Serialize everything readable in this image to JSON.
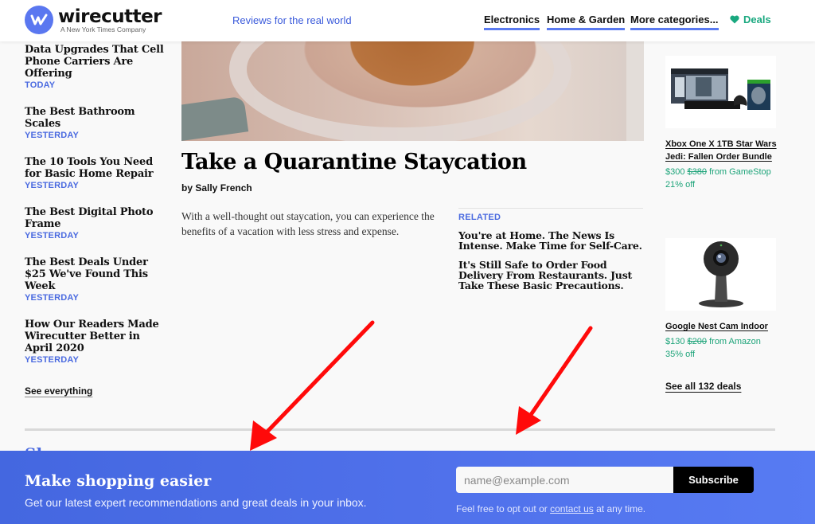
{
  "header": {
    "logo_word": "wirecutter",
    "logo_sub": "A New York Times Company",
    "tagline": "Reviews for the real world",
    "nav": [
      {
        "label": "Electronics"
      },
      {
        "label": "Home & Garden"
      },
      {
        "label": "More categories..."
      }
    ],
    "deals_label": "Deals",
    "deals_icon": "heart-icon",
    "colors": {
      "brand": "#5a77f0",
      "deals": "#19a87f",
      "nav_underline": "#5a7af0"
    }
  },
  "latest": {
    "stories": [
      {
        "title": "Data Upgrades That Cell Phone Carriers Are Offering",
        "date": "TODAY"
      },
      {
        "title": "The Best Bathroom Scales",
        "date": "YESTERDAY"
      },
      {
        "title": "The 10 Tools You Need for Basic Home Repair",
        "date": "YESTERDAY"
      },
      {
        "title": "The Best Digital Photo Frame",
        "date": "YESTERDAY"
      },
      {
        "title": "The Best Deals Under $25 We've Found This Week",
        "date": "YESTERDAY"
      },
      {
        "title": "How Our Readers Made Wirecutter Better in April 2020",
        "date": "YESTERDAY"
      }
    ],
    "see_everything": "See everything"
  },
  "feature": {
    "title": "Take a Quarantine Staycation",
    "byline": "by Sally French",
    "dek": "With a well-thought out staycation, you can experience the benefits of a vacation with less stress and expense.",
    "related_label": "RELATED",
    "related": [
      {
        "title": "You're at Home. The News Is Intense. Make Time for Self-Care."
      },
      {
        "title": "It's Still Safe to Order Food Delivery From Restaurants. Just Take These Basic Precautions."
      }
    ]
  },
  "deals": {
    "items": [
      {
        "name": "Xbox One X 1TB Star Wars Jedi: Fallen Order Bundle",
        "price": "$300",
        "was": "$380",
        "from": "from GameStop",
        "off": "21% off"
      },
      {
        "name": "Google Nest Cam Indoor",
        "price": "$130",
        "was": "$200",
        "from": "from Amazon",
        "off": "35% off"
      }
    ],
    "see_all": "See all 132 deals"
  },
  "hidden_heading": "Sho",
  "newsletter": {
    "title": "Make shopping easier",
    "subtitle": "Get our latest expert recommendations and great deals in your inbox.",
    "email_placeholder": "name@example.com",
    "email_value": "",
    "subscribe_label": "Subscribe",
    "optout_prefix": "Feel free to opt out or ",
    "optout_link": "contact us",
    "optout_suffix": " at any time."
  },
  "annotations": {
    "arrow_color": "#ff0000",
    "arrow_count": 2
  }
}
